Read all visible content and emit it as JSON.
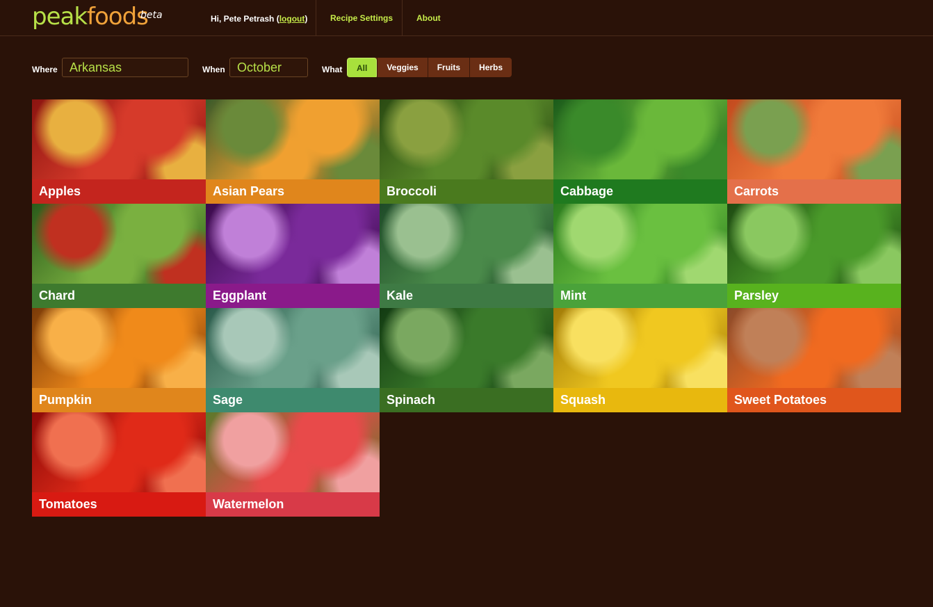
{
  "logo": {
    "part1": "peak",
    "part2": "foods",
    "beta": "beta"
  },
  "header": {
    "greeting": "Hi, Pete Petrash (",
    "logout": "logout",
    "greeting_end": ")",
    "nav": [
      "Recipe Settings",
      "About"
    ]
  },
  "filters": {
    "where_label": "Where",
    "where_value": "Arkansas",
    "when_label": "When",
    "when_value": "October",
    "what_label": "What",
    "categories": [
      "All",
      "Veggies",
      "Fruits",
      "Herbs"
    ],
    "active_category": "All"
  },
  "foods": [
    {
      "name": "Apples",
      "color": "#c4251e",
      "photo": [
        "#8b1410",
        "#d63a2a",
        "#e8b040"
      ]
    },
    {
      "name": "Asian Pears",
      "color": "#e0861c",
      "photo": [
        "#3a5a2a",
        "#f0a030",
        "#6a8a3a"
      ]
    },
    {
      "name": "Broccoli",
      "color": "#4a7a1e",
      "photo": [
        "#2a4a12",
        "#5a8a2a",
        "#8aa040"
      ]
    },
    {
      "name": "Cabbage",
      "color": "#1f7a1f",
      "photo": [
        "#1a5a1a",
        "#6ab83a",
        "#3a8a2a"
      ]
    },
    {
      "name": "Carrots",
      "color": "#e4704a",
      "photo": [
        "#c24a1e",
        "#f07a3a",
        "#7aa050"
      ]
    },
    {
      "name": "Chard",
      "color": "#3e7a2e",
      "photo": [
        "#2a5a1a",
        "#7ab040",
        "#c03020"
      ]
    },
    {
      "name": "Eggplant",
      "color": "#8a1a8a",
      "photo": [
        "#3a0a4a",
        "#7a2a9a",
        "#c080d8"
      ]
    },
    {
      "name": "Kale",
      "color": "#3e7a44",
      "photo": [
        "#1e4a28",
        "#4a8a4a",
        "#9ac090"
      ]
    },
    {
      "name": "Mint",
      "color": "#4aa23a",
      "photo": [
        "#2a7a1e",
        "#6ac040",
        "#a0d870"
      ]
    },
    {
      "name": "Parsley",
      "color": "#58b21e",
      "photo": [
        "#1e4a12",
        "#4a9a2a",
        "#8ac860"
      ]
    },
    {
      "name": "Pumpkin",
      "color": "#e0861c",
      "photo": [
        "#7a3a08",
        "#f08a1a",
        "#f8b048"
      ]
    },
    {
      "name": "Sage",
      "color": "#3e8a6e",
      "photo": [
        "#2a5a4a",
        "#6aa08a",
        "#a8c8b8"
      ]
    },
    {
      "name": "Spinach",
      "color": "#3a6e22",
      "photo": [
        "#123a12",
        "#3a7a2a",
        "#7aa860"
      ]
    },
    {
      "name": "Squash",
      "color": "#e8b80e",
      "photo": [
        "#a07a08",
        "#f0c820",
        "#f8e060"
      ]
    },
    {
      "name": "Sweet Potatoes",
      "color": "#e0561c",
      "photo": [
        "#8a4a2a",
        "#f06a20",
        "#c08058"
      ]
    },
    {
      "name": "Tomatoes",
      "color": "#d81a12",
      "photo": [
        "#8a0a08",
        "#e02a18",
        "#f07050"
      ]
    },
    {
      "name": "Watermelon",
      "color": "#d83a48",
      "photo": [
        "#5a7a2a",
        "#e84a4a",
        "#f0a0a0"
      ]
    }
  ]
}
